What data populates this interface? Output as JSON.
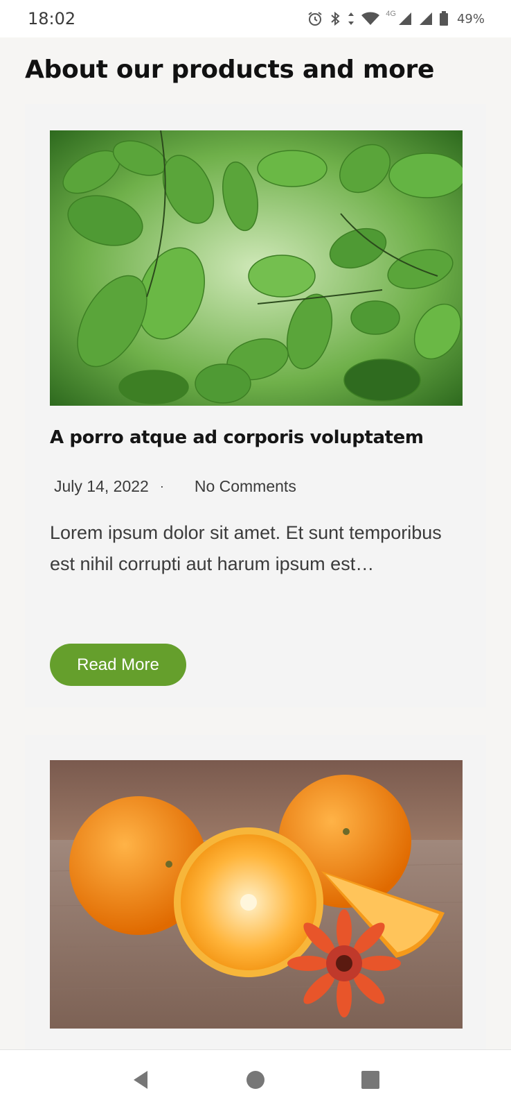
{
  "status_bar": {
    "time": "18:02",
    "network": "4G",
    "battery": "49%",
    "icons": [
      "alarm-icon",
      "bluetooth-icon",
      "data-arrows-icon",
      "wifi-icon",
      "signal-icon",
      "signal-icon",
      "battery-icon"
    ]
  },
  "page": {
    "title": "About our products and more"
  },
  "posts": [
    {
      "image": "green-leaves-photo",
      "title": "A porro atque ad corporis voluptatem",
      "date": "July 14, 2022",
      "separator": "·",
      "comments": "No Comments",
      "excerpt": "Lorem ipsum dolor sit amet. Et sunt temporibus est nihil corrupti aut harum ipsum est…",
      "button_label": "Read More"
    },
    {
      "image": "oranges-and-flower-photo"
    }
  ],
  "nav_bar": {
    "icons": [
      "back-icon",
      "home-icon",
      "recents-icon"
    ]
  },
  "colors": {
    "accent": "#659f2c",
    "background": "#f6f5f3",
    "card": "#f4f4f4"
  }
}
